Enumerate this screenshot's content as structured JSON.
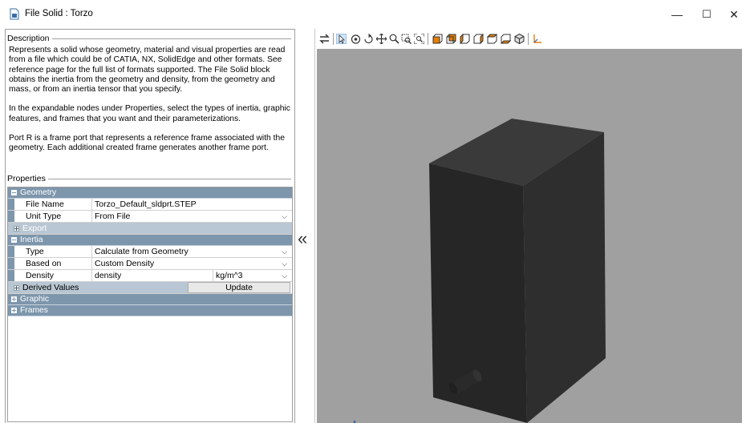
{
  "window": {
    "title": "File Solid : Torzo",
    "minimize": "—",
    "maximize": "☐",
    "close": "✕"
  },
  "description": {
    "header": "Description",
    "paragraphs": [
      "Represents a solid whose geometry, material and visual properties are read from a file which could be of CATIA, NX, SolidEdge and other formats. See reference page for the full list of formats supported. The File Solid block obtains the inertia from the geometry and density, from the geometry and mass, or from an inertia tensor that you specify.",
      "In the expandable nodes under Properties, select the types of inertia, graphic features, and frames that you want and their parameterizations.",
      "Port R is a frame port that represents a reference frame associated with the geometry. Each additional created frame generates another frame port."
    ]
  },
  "properties": {
    "header": "Properties",
    "geometry": {
      "label": "Geometry",
      "file_name_label": "File Name",
      "file_name_value": "Torzo_Default_sldprt.STEP",
      "unit_type_label": "Unit Type",
      "unit_type_value": "From File",
      "export_label": "Export"
    },
    "inertia": {
      "label": "Inertia",
      "type_label": "Type",
      "type_value": "Calculate from Geometry",
      "based_on_label": "Based on",
      "based_on_value": "Custom Density",
      "density_label": "Density",
      "density_value": "density",
      "density_unit": "kg/m^3",
      "derived_label": "Derived Values",
      "update_label": "Update"
    },
    "graphic": {
      "label": "Graphic"
    },
    "frames": {
      "label": "Frames"
    }
  },
  "collapse_glyph": "«",
  "colors": {
    "group_header": "#7d96ac",
    "subgroup": "#b9c6d3",
    "viewport_bg": "#a0a0a0",
    "solid_front": "#262626",
    "solid_side": "#2e2e2e",
    "solid_top": "#3a3a3a",
    "toolbar_orange": "#e67e00",
    "toolbar_blue": "#2a5db0"
  },
  "toolbar_icons": [
    "swap-arrows-icon",
    "select-pointer-icon",
    "orbit-eye-icon",
    "rotate-icon",
    "pan-icon",
    "zoom-icon",
    "zoom-box-icon",
    "fit-view-icon",
    "view-front-icon",
    "view-back-icon",
    "view-left-icon",
    "view-right-icon",
    "view-top-icon",
    "view-bottom-icon",
    "view-iso-icon",
    "frames-axis-icon"
  ]
}
